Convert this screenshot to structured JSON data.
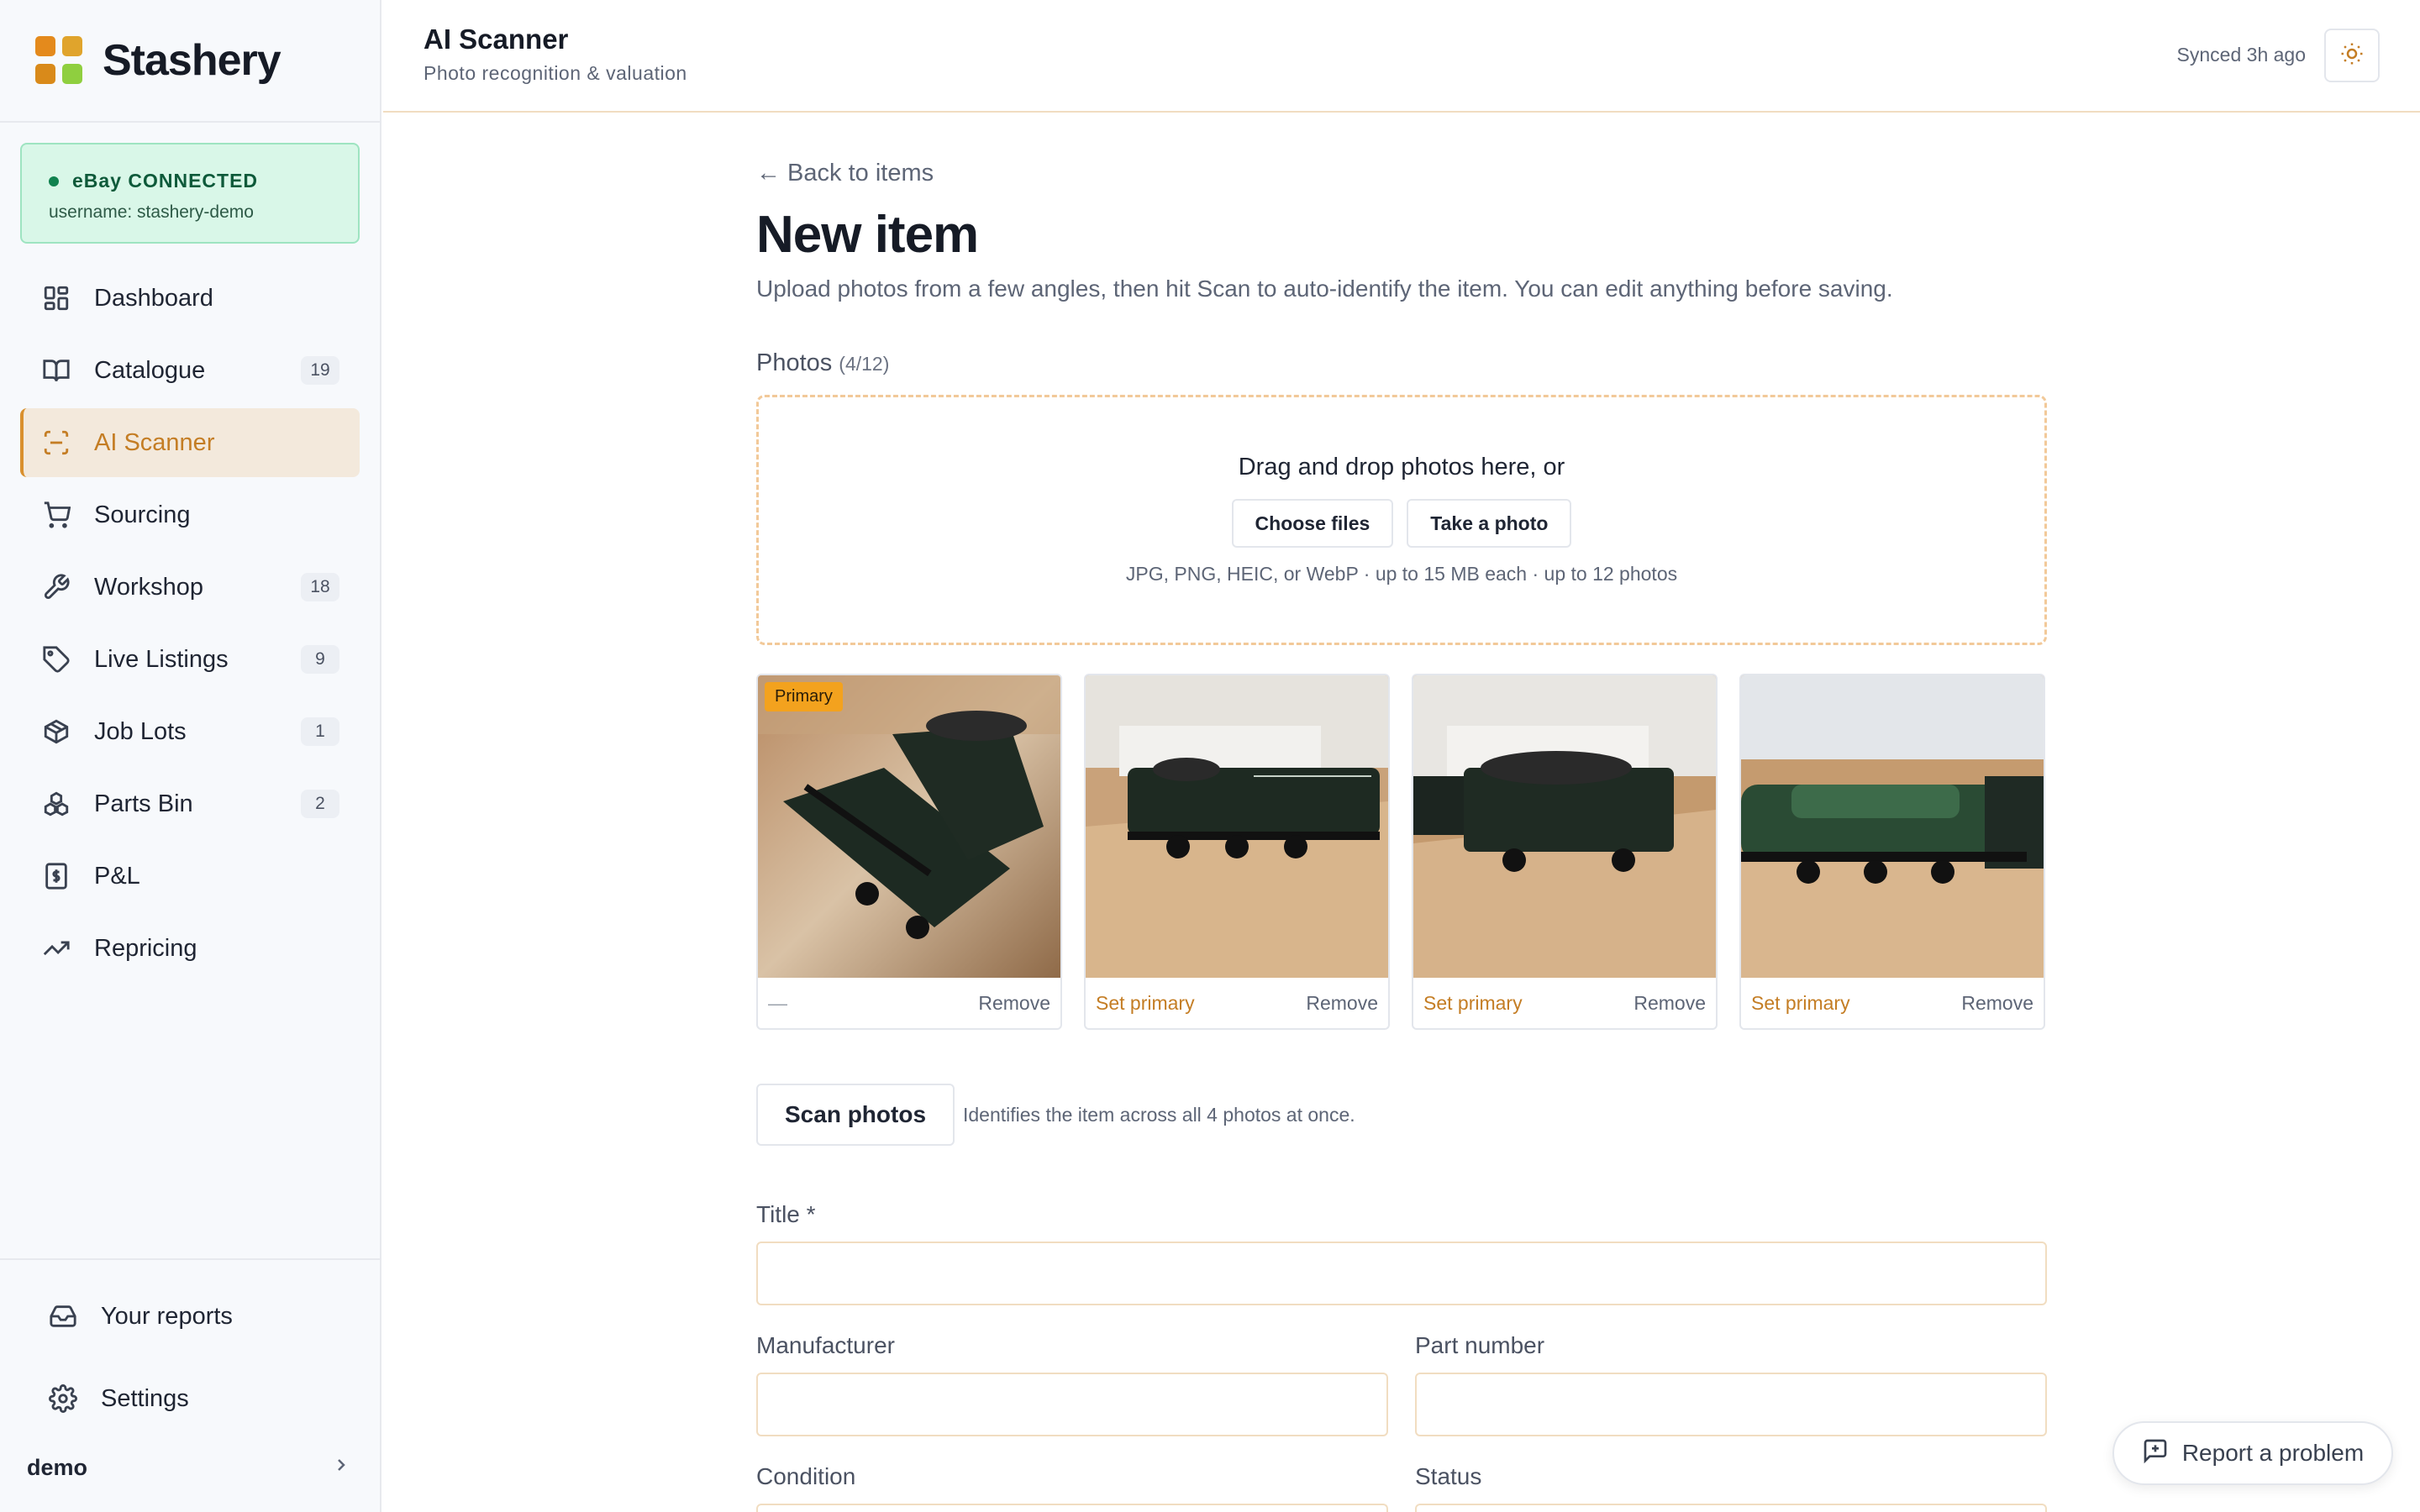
{
  "brand": {
    "name": "Stashery",
    "logo_colors": [
      "#e48a1c",
      "#e0a42c",
      "#d98a1a",
      "#8fcf3f"
    ]
  },
  "ebay": {
    "status": "eBay CONNECTED",
    "username": "username: stashery-demo"
  },
  "nav": [
    {
      "label": "Dashboard",
      "icon": "dashboard-icon",
      "badge": ""
    },
    {
      "label": "Catalogue",
      "icon": "book-icon",
      "badge": "19"
    },
    {
      "label": "AI Scanner",
      "icon": "scan-icon",
      "badge": "",
      "active": true
    },
    {
      "label": "Sourcing",
      "icon": "cart-icon",
      "badge": ""
    },
    {
      "label": "Workshop",
      "icon": "wrench-icon",
      "badge": "18"
    },
    {
      "label": "Live Listings",
      "icon": "tag-icon",
      "badge": "9"
    },
    {
      "label": "Job Lots",
      "icon": "box-icon",
      "badge": "1"
    },
    {
      "label": "Parts Bin",
      "icon": "parts-icon",
      "badge": "2"
    },
    {
      "label": "P&L",
      "icon": "dollar-icon",
      "badge": ""
    },
    {
      "label": "Repricing",
      "icon": "trend-icon",
      "badge": ""
    }
  ],
  "bottom_nav": [
    {
      "label": "Your reports",
      "icon": "inbox-icon"
    },
    {
      "label": "Settings",
      "icon": "gear-icon"
    }
  ],
  "user": {
    "name": "demo"
  },
  "header": {
    "title": "AI Scanner",
    "subtitle": "Photo recognition & valuation",
    "synced": "Synced 3h ago"
  },
  "page": {
    "back": "← Back to items",
    "title": "New item",
    "description": "Upload photos from a few angles, then hit Scan to auto-identify the item. You can edit anything before saving.",
    "photos_label": "Photos",
    "photos_count": "(4/12)",
    "dropzone": {
      "text": "Drag and drop photos here, or",
      "choose": "Choose files",
      "take": "Take a photo",
      "hint": "JPG, PNG, HEIC, or WebP · up to 15 MB each · up to 12 photos"
    },
    "photos": [
      {
        "primary_tag": "Primary",
        "left": "—",
        "right": "Remove"
      },
      {
        "left": "Set primary",
        "right": "Remove"
      },
      {
        "left": "Set primary",
        "right": "Remove"
      },
      {
        "left": "Set primary",
        "right": "Remove"
      }
    ],
    "scan_button": "Scan photos",
    "scan_note": "Identifies the item across all 4 photos at once.",
    "fields": {
      "title": {
        "label": "Title *",
        "value": ""
      },
      "manufacturer": {
        "label": "Manufacturer",
        "value": ""
      },
      "part_number": {
        "label": "Part number",
        "value": ""
      },
      "condition": {
        "label": "Condition"
      },
      "status": {
        "label": "Status"
      }
    }
  },
  "report": {
    "label": "Report a problem"
  },
  "colors": {
    "accent": "#c47d24",
    "active_bg": "#f3e9dc",
    "connected_bg": "#d9f7e8",
    "dropzone_border": "#f2c999"
  }
}
